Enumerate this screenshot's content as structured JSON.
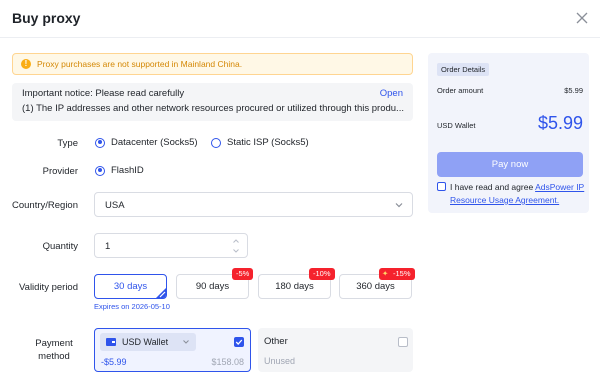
{
  "dialog": {
    "title": "Buy proxy"
  },
  "warning": {
    "text": "Proxy purchases are not supported in Mainland China."
  },
  "notice": {
    "title": "Important notice: Please read carefully",
    "open_label": "Open",
    "body": "(1) The IP addresses and other network resources procured or utilized through this produ..."
  },
  "form": {
    "type_label": "Type",
    "type_options": [
      {
        "label": "Datacenter (Socks5)",
        "selected": true
      },
      {
        "label": "Static ISP (Socks5)",
        "selected": false
      }
    ],
    "provider_label": "Provider",
    "provider_option": {
      "label": "FlashID",
      "selected": true
    },
    "region_label": "Country/Region",
    "region_value": "USA",
    "quantity_label": "Quantity",
    "quantity_value": "1",
    "validity_label": "Validity period",
    "validity_options": [
      {
        "label": "30 days",
        "discount": "",
        "selected": true
      },
      {
        "label": "90 days",
        "discount": "-5%",
        "selected": false
      },
      {
        "label": "180 days",
        "discount": "-10%",
        "selected": false
      },
      {
        "label": "360 days",
        "discount": "-15%",
        "selected": false
      }
    ],
    "expires": "Expires on 2026-05-10",
    "payment_label_1": "Payment",
    "payment_label_2": "method",
    "wallet": {
      "label": "USD Wallet",
      "amount": "-$5.99",
      "balance": "$158.08"
    },
    "other": {
      "label": "Other",
      "sub": "Unused"
    }
  },
  "order": {
    "tag": "Order Details",
    "amount_label": "Order amount",
    "amount_value": "$5.99",
    "wallet_label": "USD Wallet",
    "wallet_value": "$5.99",
    "pay_label": "Pay now",
    "agree_text": "I have read and agree",
    "agree_link": "AdsPower IP Resource Usage Agreement."
  },
  "colors": {
    "accent": "#2f54eb",
    "badge": "#f5222d",
    "warning": "#faad14"
  }
}
